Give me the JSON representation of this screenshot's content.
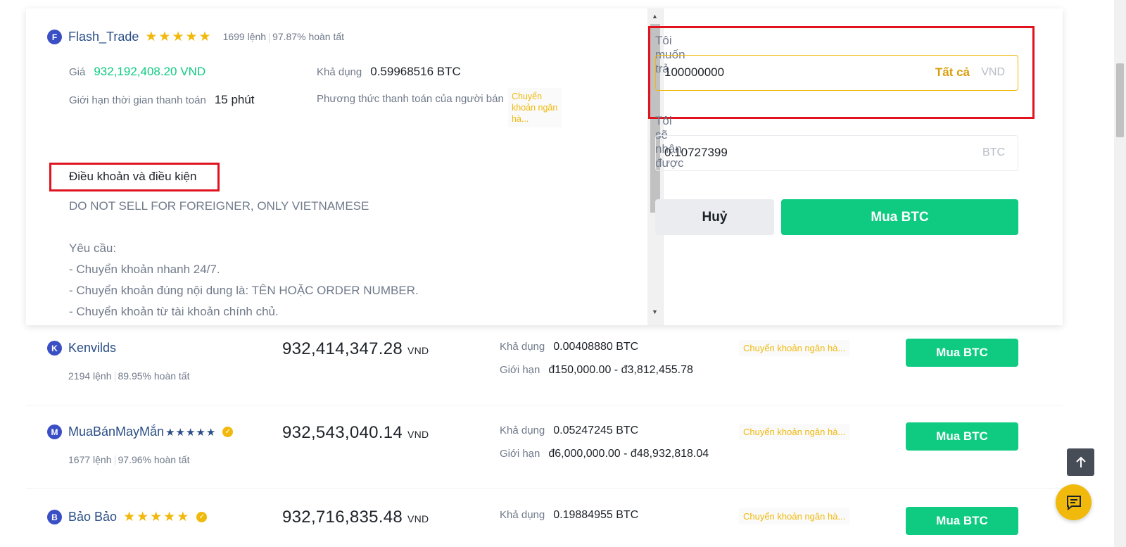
{
  "selected_offer": {
    "avatar_letter": "F",
    "trader": "Flash_Trade",
    "stars": "★★★★★",
    "orders": "1699 lệnh",
    "completion": "97.87% hoàn tất",
    "price_label": "Giá",
    "price": "932,192,408.20 VND",
    "available_label": "Khả dụng",
    "available": "0.59968516 BTC",
    "time_limit_label": "Giới hạn thời gian thanh toán",
    "time_limit": "15 phút",
    "payment_label": "Phương thức thanh toán của người bán",
    "payment_tag": "Chuyển khoản ngân hà...",
    "terms_title": "Điều khoản và điều kiện",
    "terms_lines": [
      "DO NOT SELL FOR FOREIGNER, ONLY VIETNAMESE",
      "",
      "Yêu cầu:",
      "- Chuyển khoản nhanh 24/7.",
      "- Chuyển khoản đúng nội dung là: TÊN HOẶC ORDER NUMBER.",
      "- Chuyển khoản từ tài khoản chính chủ."
    ]
  },
  "order_form": {
    "pay_label": "Tôi muốn trả",
    "pay_value": "100000000",
    "pay_all": "Tất cả",
    "pay_unit": "VND",
    "receive_label": "Tôi sẽ nhận được",
    "receive_value": "0.10727399",
    "receive_unit": "BTC",
    "cancel_label": "Huỷ",
    "buy_label": "Mua BTC"
  },
  "rows": [
    {
      "avatar_letter": "K",
      "trader": "Kenvilds",
      "orders": "2194 lệnh",
      "completion": "89.95% hoàn tất",
      "price": "932,414,347.28",
      "currency": "VND",
      "available_label": "Khả dụng",
      "available": "0.00408880 BTC",
      "limit_label": "Giới hạn",
      "limit": "đ150,000.00 - đ3,812,455.78",
      "payment_tag": "Chuyển khoản ngân hà...",
      "buy_label": "Mua BTC"
    },
    {
      "avatar_letter": "M",
      "trader": "MuaBánMayMắn",
      "name_stars": "★★★★★",
      "orders": "1677 lệnh",
      "completion": "97.96% hoàn tất",
      "price": "932,543,040.14",
      "currency": "VND",
      "available_label": "Khả dụng",
      "available": "0.05247245 BTC",
      "limit_label": "Giới hạn",
      "limit": "đ6,000,000.00 - đ48,932,818.04",
      "payment_tag": "Chuyển khoản ngân hà...",
      "buy_label": "Mua BTC"
    },
    {
      "avatar_letter": "B",
      "trader": "Bảo Bảo",
      "stars": "★★★★★",
      "price": "932,716,835.48",
      "currency": "VND",
      "available_label": "Khả dụng",
      "available": "0.19884955 BTC",
      "payment_tag": "Chuyển khoản ngân hà...",
      "buy_label": "Mua BTC"
    }
  ],
  "colors": {
    "accent_yellow": "#f0b90b",
    "buy_green": "#0ecb81",
    "highlight_red": "#e0131f",
    "link_blue": "#2a4e86"
  },
  "icons": {
    "verified": "verified-badge-icon",
    "scroll_top": "arrow-up-icon",
    "chat": "chat-icon"
  }
}
